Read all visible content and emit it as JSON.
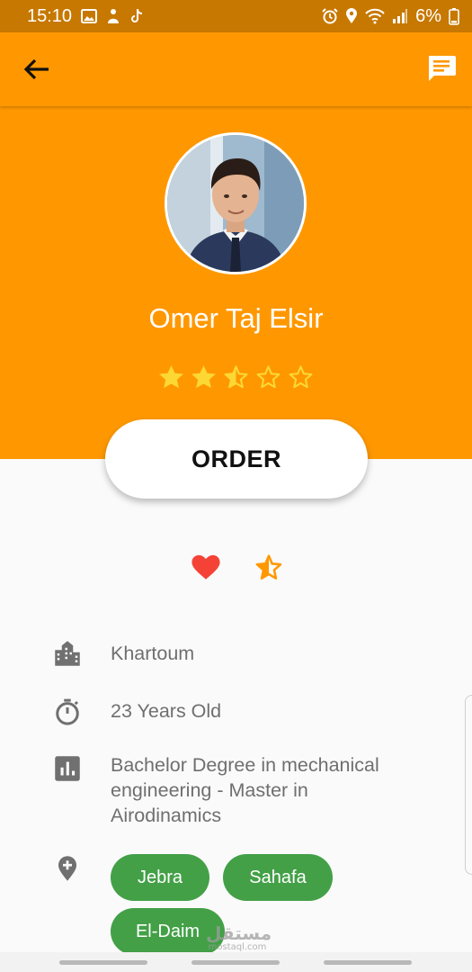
{
  "status_bar": {
    "time": "15:10",
    "battery": "6%",
    "left_icons": [
      "gallery-icon",
      "pet-icon",
      "tiktok-icon"
    ],
    "right_icons": [
      "alarm-icon",
      "location-icon",
      "wifi-icon",
      "signal-icon",
      "battery-icon"
    ]
  },
  "app_bar": {
    "back_icon": "arrow-back-icon",
    "chat_icon": "chat-icon"
  },
  "profile": {
    "name": "Omer Taj Elsir",
    "rating": 2.5,
    "rating_max": 5
  },
  "order_button": {
    "label": "ORDER"
  },
  "actions": {
    "heart_icon": "heart-icon",
    "star_icon": "star-half-icon"
  },
  "info": {
    "city": "Khartoum",
    "age": "23 Years Old",
    "education": "Bachelor Degree in mechanical engineering - Master in Airodinamics",
    "locations": [
      "Jebra",
      "Sahafa",
      "El-Daim"
    ]
  },
  "watermark": {
    "text": "مستقل",
    "sub": "mostaql.com"
  },
  "colors": {
    "primary": "#ff9800",
    "status_bar": "#c77800",
    "star": "#fdd835",
    "heart": "#f44336",
    "chip": "#43a047",
    "text_secondary": "#6f6f6f"
  }
}
